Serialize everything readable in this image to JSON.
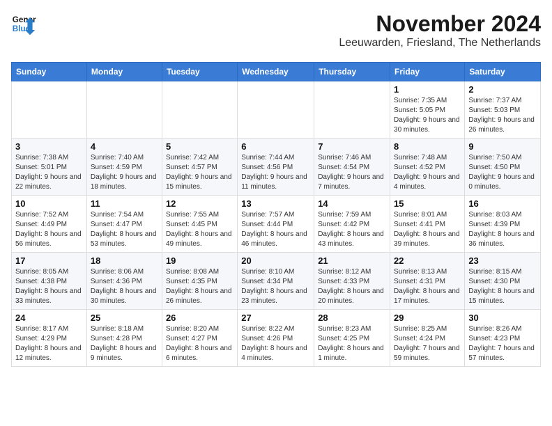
{
  "header": {
    "logo_line1": "General",
    "logo_line2": "Blue",
    "month_title": "November 2024",
    "subtitle": "Leeuwarden, Friesland, The Netherlands"
  },
  "days_of_week": [
    "Sunday",
    "Monday",
    "Tuesday",
    "Wednesday",
    "Thursday",
    "Friday",
    "Saturday"
  ],
  "weeks": [
    [
      {
        "day": "",
        "info": ""
      },
      {
        "day": "",
        "info": ""
      },
      {
        "day": "",
        "info": ""
      },
      {
        "day": "",
        "info": ""
      },
      {
        "day": "",
        "info": ""
      },
      {
        "day": "1",
        "info": "Sunrise: 7:35 AM\nSunset: 5:05 PM\nDaylight: 9 hours and 30 minutes."
      },
      {
        "day": "2",
        "info": "Sunrise: 7:37 AM\nSunset: 5:03 PM\nDaylight: 9 hours and 26 minutes."
      }
    ],
    [
      {
        "day": "3",
        "info": "Sunrise: 7:38 AM\nSunset: 5:01 PM\nDaylight: 9 hours and 22 minutes."
      },
      {
        "day": "4",
        "info": "Sunrise: 7:40 AM\nSunset: 4:59 PM\nDaylight: 9 hours and 18 minutes."
      },
      {
        "day": "5",
        "info": "Sunrise: 7:42 AM\nSunset: 4:57 PM\nDaylight: 9 hours and 15 minutes."
      },
      {
        "day": "6",
        "info": "Sunrise: 7:44 AM\nSunset: 4:56 PM\nDaylight: 9 hours and 11 minutes."
      },
      {
        "day": "7",
        "info": "Sunrise: 7:46 AM\nSunset: 4:54 PM\nDaylight: 9 hours and 7 minutes."
      },
      {
        "day": "8",
        "info": "Sunrise: 7:48 AM\nSunset: 4:52 PM\nDaylight: 9 hours and 4 minutes."
      },
      {
        "day": "9",
        "info": "Sunrise: 7:50 AM\nSunset: 4:50 PM\nDaylight: 9 hours and 0 minutes."
      }
    ],
    [
      {
        "day": "10",
        "info": "Sunrise: 7:52 AM\nSunset: 4:49 PM\nDaylight: 8 hours and 56 minutes."
      },
      {
        "day": "11",
        "info": "Sunrise: 7:54 AM\nSunset: 4:47 PM\nDaylight: 8 hours and 53 minutes."
      },
      {
        "day": "12",
        "info": "Sunrise: 7:55 AM\nSunset: 4:45 PM\nDaylight: 8 hours and 49 minutes."
      },
      {
        "day": "13",
        "info": "Sunrise: 7:57 AM\nSunset: 4:44 PM\nDaylight: 8 hours and 46 minutes."
      },
      {
        "day": "14",
        "info": "Sunrise: 7:59 AM\nSunset: 4:42 PM\nDaylight: 8 hours and 43 minutes."
      },
      {
        "day": "15",
        "info": "Sunrise: 8:01 AM\nSunset: 4:41 PM\nDaylight: 8 hours and 39 minutes."
      },
      {
        "day": "16",
        "info": "Sunrise: 8:03 AM\nSunset: 4:39 PM\nDaylight: 8 hours and 36 minutes."
      }
    ],
    [
      {
        "day": "17",
        "info": "Sunrise: 8:05 AM\nSunset: 4:38 PM\nDaylight: 8 hours and 33 minutes."
      },
      {
        "day": "18",
        "info": "Sunrise: 8:06 AM\nSunset: 4:36 PM\nDaylight: 8 hours and 30 minutes."
      },
      {
        "day": "19",
        "info": "Sunrise: 8:08 AM\nSunset: 4:35 PM\nDaylight: 8 hours and 26 minutes."
      },
      {
        "day": "20",
        "info": "Sunrise: 8:10 AM\nSunset: 4:34 PM\nDaylight: 8 hours and 23 minutes."
      },
      {
        "day": "21",
        "info": "Sunrise: 8:12 AM\nSunset: 4:33 PM\nDaylight: 8 hours and 20 minutes."
      },
      {
        "day": "22",
        "info": "Sunrise: 8:13 AM\nSunset: 4:31 PM\nDaylight: 8 hours and 17 minutes."
      },
      {
        "day": "23",
        "info": "Sunrise: 8:15 AM\nSunset: 4:30 PM\nDaylight: 8 hours and 15 minutes."
      }
    ],
    [
      {
        "day": "24",
        "info": "Sunrise: 8:17 AM\nSunset: 4:29 PM\nDaylight: 8 hours and 12 minutes."
      },
      {
        "day": "25",
        "info": "Sunrise: 8:18 AM\nSunset: 4:28 PM\nDaylight: 8 hours and 9 minutes."
      },
      {
        "day": "26",
        "info": "Sunrise: 8:20 AM\nSunset: 4:27 PM\nDaylight: 8 hours and 6 minutes."
      },
      {
        "day": "27",
        "info": "Sunrise: 8:22 AM\nSunset: 4:26 PM\nDaylight: 8 hours and 4 minutes."
      },
      {
        "day": "28",
        "info": "Sunrise: 8:23 AM\nSunset: 4:25 PM\nDaylight: 8 hours and 1 minute."
      },
      {
        "day": "29",
        "info": "Sunrise: 8:25 AM\nSunset: 4:24 PM\nDaylight: 7 hours and 59 minutes."
      },
      {
        "day": "30",
        "info": "Sunrise: 8:26 AM\nSunset: 4:23 PM\nDaylight: 7 hours and 57 minutes."
      }
    ]
  ]
}
